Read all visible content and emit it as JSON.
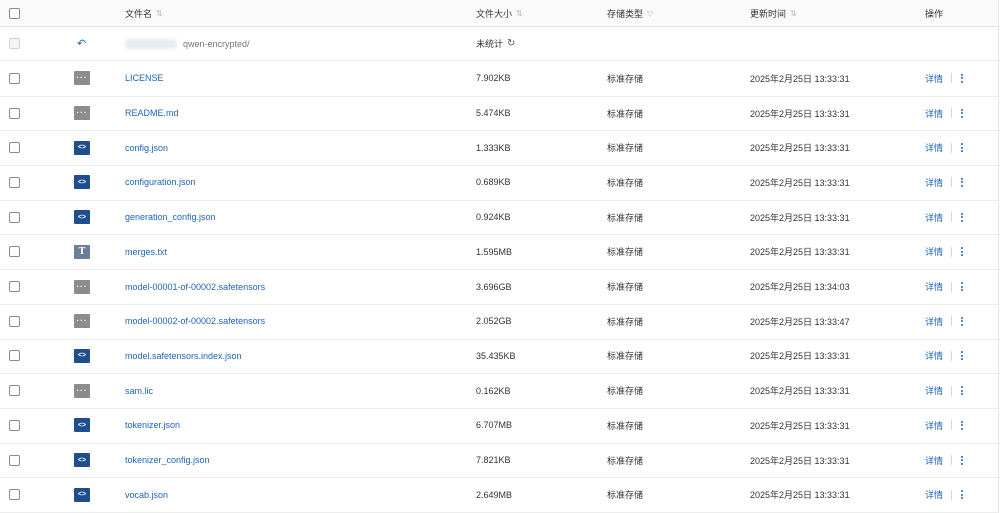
{
  "header": {
    "name": "文件名",
    "size": "文件大小",
    "type": "存储类型",
    "time": "更新时间",
    "ops": "操作"
  },
  "parent_row": {
    "path": "qwen-encrypted/",
    "size": "未统计"
  },
  "icons": {
    "sort": "sort-arrows-icon",
    "filter": "filter-icon",
    "back": "back-arrow-icon",
    "refresh": "refresh-icon"
  },
  "detail_label": "详情",
  "files": [
    {
      "name": "LICENSE",
      "size": "7.902KB",
      "type": "标准存储",
      "time": "2025年2月25日 13:33:31",
      "icon": "generic"
    },
    {
      "name": "README.md",
      "size": "5.474KB",
      "type": "标准存储",
      "time": "2025年2月25日 13:33:31",
      "icon": "generic"
    },
    {
      "name": "config.json",
      "size": "1.333KB",
      "type": "标准存储",
      "time": "2025年2月25日 13:33:31",
      "icon": "code"
    },
    {
      "name": "configuration.json",
      "size": "0.689KB",
      "type": "标准存储",
      "time": "2025年2月25日 13:33:31",
      "icon": "code"
    },
    {
      "name": "generation_config.json",
      "size": "0.924KB",
      "type": "标准存储",
      "time": "2025年2月25日 13:33:31",
      "icon": "code"
    },
    {
      "name": "merges.txt",
      "size": "1.595MB",
      "type": "标准存储",
      "time": "2025年2月25日 13:33:31",
      "icon": "text"
    },
    {
      "name": "model-00001-of-00002.safetensors",
      "size": "3.696GB",
      "type": "标准存储",
      "time": "2025年2月25日 13:34:03",
      "icon": "generic"
    },
    {
      "name": "model-00002-of-00002.safetensors",
      "size": "2.052GB",
      "type": "标准存储",
      "time": "2025年2月25日 13:33:47",
      "icon": "generic"
    },
    {
      "name": "model.safetensors.index.json",
      "size": "35.435KB",
      "type": "标准存储",
      "time": "2025年2月25日 13:33:31",
      "icon": "code"
    },
    {
      "name": "sam.lic",
      "size": "0.162KB",
      "type": "标准存储",
      "time": "2025年2月25日 13:33:31",
      "icon": "generic"
    },
    {
      "name": "tokenizer.json",
      "size": "6.707MB",
      "type": "标准存储",
      "time": "2025年2月25日 13:33:31",
      "icon": "code"
    },
    {
      "name": "tokenizer_config.json",
      "size": "7.821KB",
      "type": "标准存储",
      "time": "2025年2月25日 13:33:31",
      "icon": "code"
    },
    {
      "name": "vocab.json",
      "size": "2.649MB",
      "type": "标准存储",
      "time": "2025年2月25日 13:33:31",
      "icon": "code"
    }
  ]
}
